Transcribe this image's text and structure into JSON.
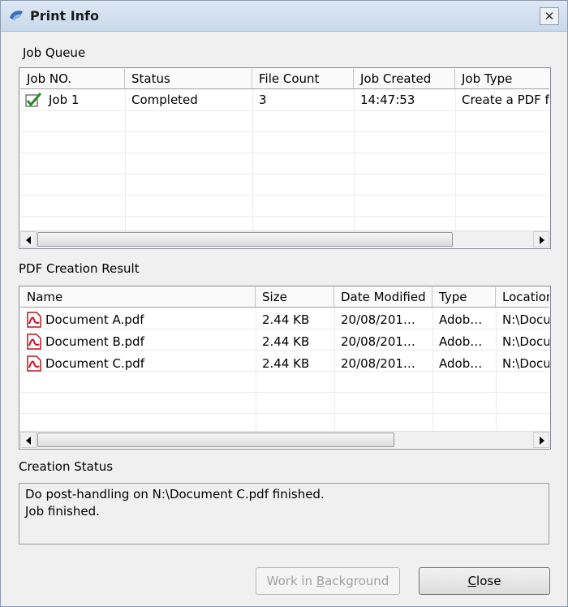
{
  "window": {
    "title": "Print Info",
    "close_glyph": "✕"
  },
  "job_queue": {
    "label": "Job Queue",
    "columns": [
      "Job NO.",
      "Status",
      "File Count",
      "Job Created",
      "Job Type"
    ],
    "rows": [
      {
        "icon": "check-icon",
        "job_no": "Job 1",
        "status": "Completed",
        "file_count": "3",
        "job_created": "14:47:53",
        "job_type": "Create a PDF f"
      }
    ]
  },
  "pdf_result": {
    "label": "PDF Creation Result",
    "columns": [
      "Name",
      "Size",
      "Date Modified",
      "Type",
      "Location"
    ],
    "rows": [
      {
        "icon": "pdf-file-icon",
        "name": "Document A.pdf",
        "size": "2.44 KB",
        "date": "20/08/201…",
        "type": "Adob…",
        "location": "N:\\Docu"
      },
      {
        "icon": "pdf-file-icon",
        "name": "Document B.pdf",
        "size": "2.44 KB",
        "date": "20/08/201…",
        "type": "Adob…",
        "location": "N:\\Docu"
      },
      {
        "icon": "pdf-file-icon",
        "name": "Document C.pdf",
        "size": "2.44 KB",
        "date": "20/08/201…",
        "type": "Adob…",
        "location": "N:\\Docu"
      }
    ]
  },
  "creation_status": {
    "label": "Creation Status",
    "lines": [
      "Do post-handling on N:\\Document C.pdf finished.",
      "Job finished."
    ]
  },
  "buttons": {
    "background": {
      "pre": "Work in ",
      "accel": "B",
      "post": "ackground"
    },
    "close": {
      "pre": "",
      "accel": "C",
      "post": "lose"
    }
  }
}
